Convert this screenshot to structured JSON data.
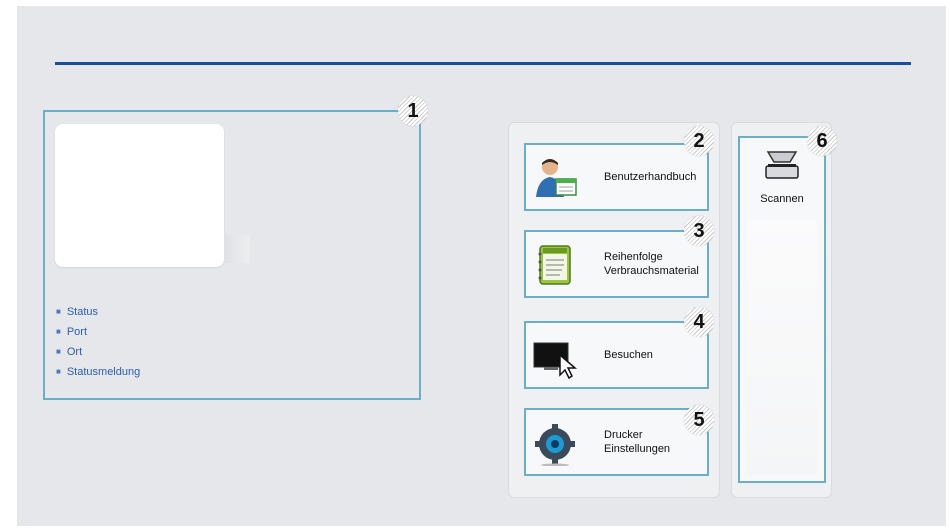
{
  "printer_panel": {
    "badge": "1",
    "info_items": [
      "Status",
      "Port",
      "Ort",
      "Statusmeldung"
    ]
  },
  "actions": [
    {
      "badge": "2",
      "label": "Benutzerhandbuch",
      "icon": "user-manual-icon"
    },
    {
      "badge": "3",
      "label_line1": "Reihenfolge",
      "label_line2": "Verbrauchsmaterial",
      "icon": "order-notebook-icon"
    },
    {
      "badge": "4",
      "label": "Besuchen",
      "icon": "monitor-cursor-icon"
    },
    {
      "badge": "5",
      "label_line1": "Drucker",
      "label_line2": "Einstellungen",
      "icon": "printer-settings-gear-icon"
    }
  ],
  "scan": {
    "badge": "6",
    "label": "Scannen",
    "icon": "scanner-icon"
  },
  "colors": {
    "accent_line": "#1a4fa0",
    "panel_border": "#6aafc7",
    "link": "#2a5fb0"
  }
}
